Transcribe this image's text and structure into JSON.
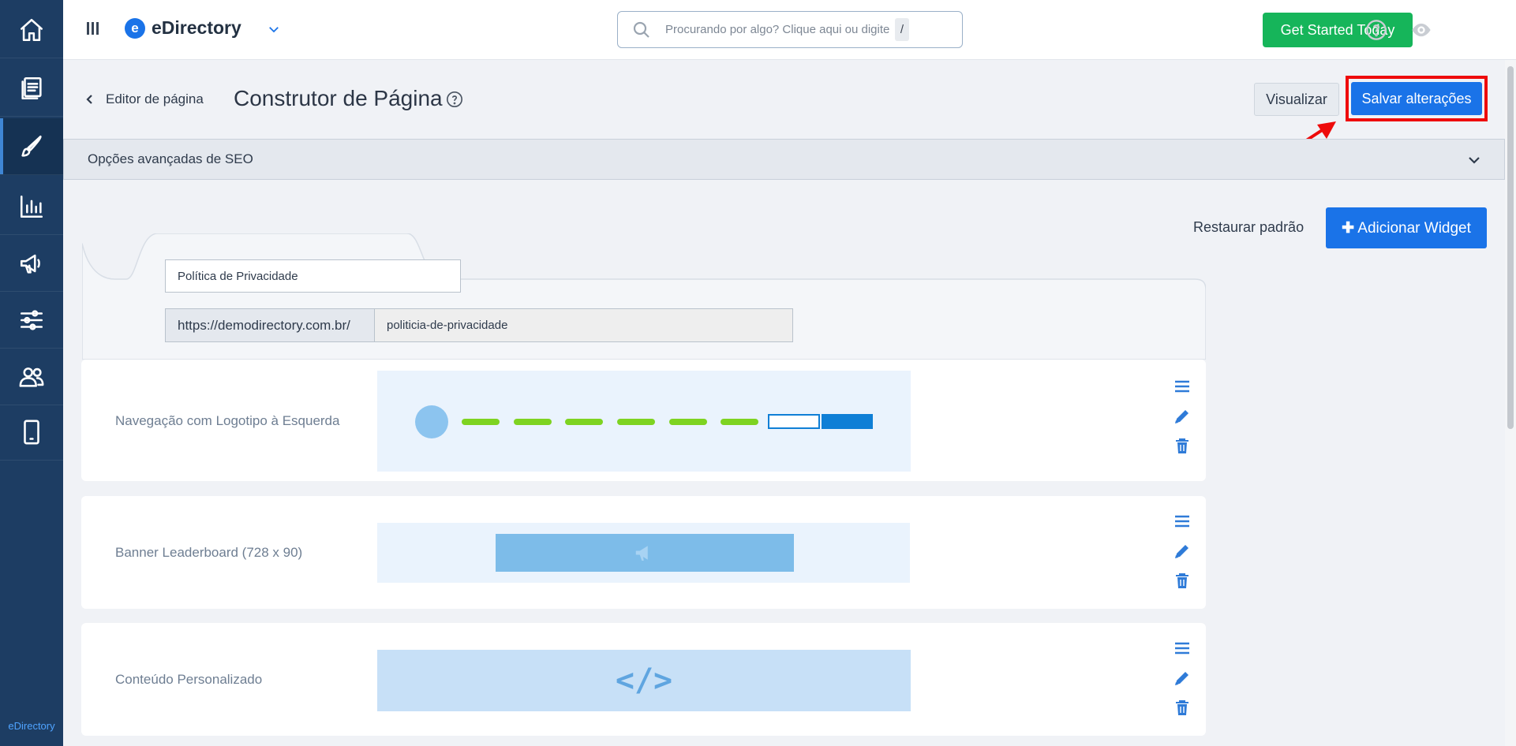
{
  "sidebar": {
    "items": [
      {
        "icon": "home-icon",
        "label": "Home"
      },
      {
        "icon": "content-icon",
        "label": "Content"
      },
      {
        "icon": "brush-icon",
        "label": "Design",
        "active": true
      },
      {
        "icon": "chart-icon",
        "label": "Reports"
      },
      {
        "icon": "megaphone-icon",
        "label": "Promote"
      },
      {
        "icon": "sliders-icon",
        "label": "Settings"
      },
      {
        "icon": "users-icon",
        "label": "Users"
      },
      {
        "icon": "mobile-icon",
        "label": "Mobile"
      }
    ],
    "footer": "eDirectory"
  },
  "topbar": {
    "brand": "eDirectory",
    "brand_logo_letter": "e",
    "search_placeholder": "Procurando por algo? Clique aqui ou digite",
    "search_shortcut": "/",
    "cta": "Get Started Today"
  },
  "header": {
    "back_label": "Editor de página",
    "title": "Construtor de Página",
    "preview_label": "Visualizar",
    "save_label": "Salvar alterações"
  },
  "seo": {
    "label": "Opções avançadas de SEO"
  },
  "toolbar": {
    "restore_label": "Restaurar padrão",
    "add_widget_label": "Adicionar Widget",
    "add_widget_icon": "plus-icon"
  },
  "page": {
    "name": "Política de Privacidade",
    "url_prefix": "https://demodirectory.com.br/",
    "slug": "politicia-de-privacidade"
  },
  "widgets": [
    {
      "label": "Navegação com Logotipo à Esquerda",
      "preview": "navigation"
    },
    {
      "label": "Banner Leaderboard (728 x 90)",
      "preview": "banner"
    },
    {
      "label": "Conteúdo Personalizado",
      "preview": "custom-code"
    }
  ],
  "code_glyph": "</>",
  "colors": {
    "sidebar": "#1d3d63",
    "primary": "#1a73e8",
    "cta_green": "#16b55a",
    "highlight_red": "#ee0b0b",
    "action_blue": "#2f7bd8"
  }
}
